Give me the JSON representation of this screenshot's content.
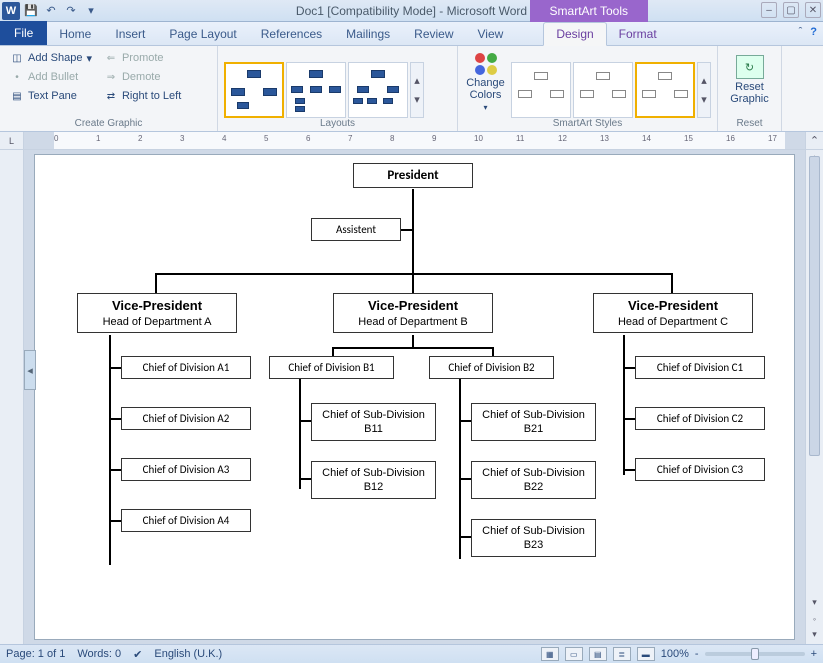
{
  "window": {
    "title": "Doc1 [Compatibility Mode] - Microsoft Word",
    "context_tab_group": "SmartArt Tools"
  },
  "tabs": {
    "file": "File",
    "items": [
      "Home",
      "Insert",
      "Page Layout",
      "References",
      "Mailings",
      "Review",
      "View"
    ],
    "context": [
      "Design",
      "Format"
    ],
    "active": "Design"
  },
  "ribbon": {
    "create_graphic": {
      "label": "Create Graphic",
      "add_shape": "Add Shape",
      "add_bullet": "Add Bullet",
      "text_pane": "Text Pane",
      "promote": "Promote",
      "demote": "Demote",
      "rtl": "Right to Left"
    },
    "layouts": {
      "label": "Layouts"
    },
    "styles": {
      "label": "SmartArt Styles",
      "change_colors": "Change Colors"
    },
    "reset": {
      "label": "Reset",
      "button": "Reset Graphic"
    }
  },
  "chart_data": {
    "type": "org-chart",
    "root": {
      "title": "President"
    },
    "assistant": {
      "title": "Assistent"
    },
    "vps": [
      {
        "title": "Vice-President",
        "subtitle": "Head of Department A",
        "children": [
          "Chief of Division  A1",
          "Chief of Division  A2",
          "Chief of Division  A3",
          "Chief of Division  A4"
        ]
      },
      {
        "title": "Vice-President",
        "subtitle": "Head of Department B",
        "children_left": [
          {
            "title": "Chief of Division  B1",
            "subs": [
              "Chief of Sub-Division  B11",
              "Chief of Sub-Division  B12"
            ]
          }
        ],
        "children_right": [
          {
            "title": "Chief of Division  B2",
            "subs": [
              "Chief of Sub-Division  B21",
              "Chief of Sub-Division  B22",
              "Chief of Sub-Division  B23"
            ]
          }
        ]
      },
      {
        "title": "Vice-President",
        "subtitle": "Head of Department C",
        "children": [
          "Chief of Division  C1",
          "Chief of Division  C2",
          "Chief of Division  C3"
        ]
      }
    ]
  },
  "status": {
    "page": "Page: 1 of 1",
    "words": "Words: 0",
    "lang": "English (U.K.)",
    "zoom": "100%",
    "zoom_minus": "-",
    "zoom_plus": "+"
  }
}
